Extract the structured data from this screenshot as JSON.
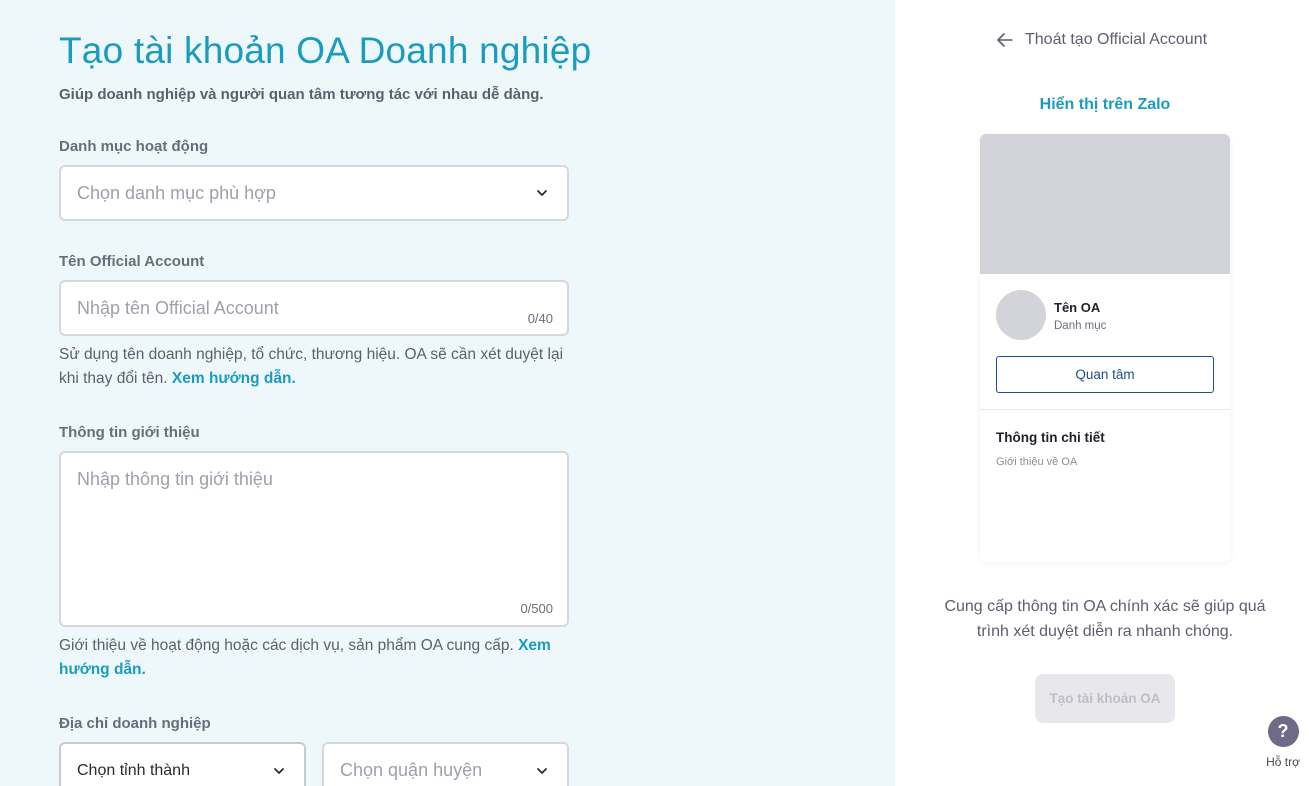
{
  "form": {
    "title": "Tạo tài khoản OA Doanh nghiệp",
    "subtitle": "Giúp doanh nghiệp và người quan tâm tương tác với nhau dễ dàng.",
    "category": {
      "label": "Danh mục hoạt động",
      "placeholder": "Chọn danh mục phù hợp"
    },
    "oa_name": {
      "label": "Tên Official Account",
      "placeholder": "Nhập tên Official Account",
      "counter": "0/40",
      "help": "Sử dụng tên doanh nghiệp, tổ chức, thương hiệu. OA sẽ cần xét duyệt lại khi thay đổi tên.",
      "help_link": "Xem hướng dẫn."
    },
    "intro": {
      "label": "Thông tin giới thiệu",
      "placeholder": "Nhập thông tin giới thiệu",
      "counter": "0/500",
      "help": "Giới thiệu về hoạt động hoặc các dịch vụ, sản phẩm OA cung cấp.",
      "help_link": "Xem hướng dẫn."
    },
    "address": {
      "label": "Địa chỉ doanh nghiệp",
      "province_value": "Chọn tỉnh thành",
      "district_placeholder": "Chọn quận huyện"
    }
  },
  "preview": {
    "exit_label": "Thoát tạo Official Account",
    "title": "Hiển thị trên Zalo",
    "oa_name": "Tên OA",
    "oa_category": "Danh mục",
    "follow_label": "Quan tâm",
    "detail_title": "Thông tin chi tiết",
    "detail_sub": "Giới thiệu về OA",
    "info_text": "Cung cấp thông tin OA chính xác sẽ giúp quá trình xét duyệt diễn ra nhanh chóng.",
    "create_label": "Tạo tài khoản OA"
  },
  "support": {
    "icon": "?",
    "label": "Hỗ trợ"
  },
  "colors": {
    "accent": "#1a9cc1",
    "follow_border": "#1d4f8f",
    "left_bg": "#eef8fb"
  }
}
